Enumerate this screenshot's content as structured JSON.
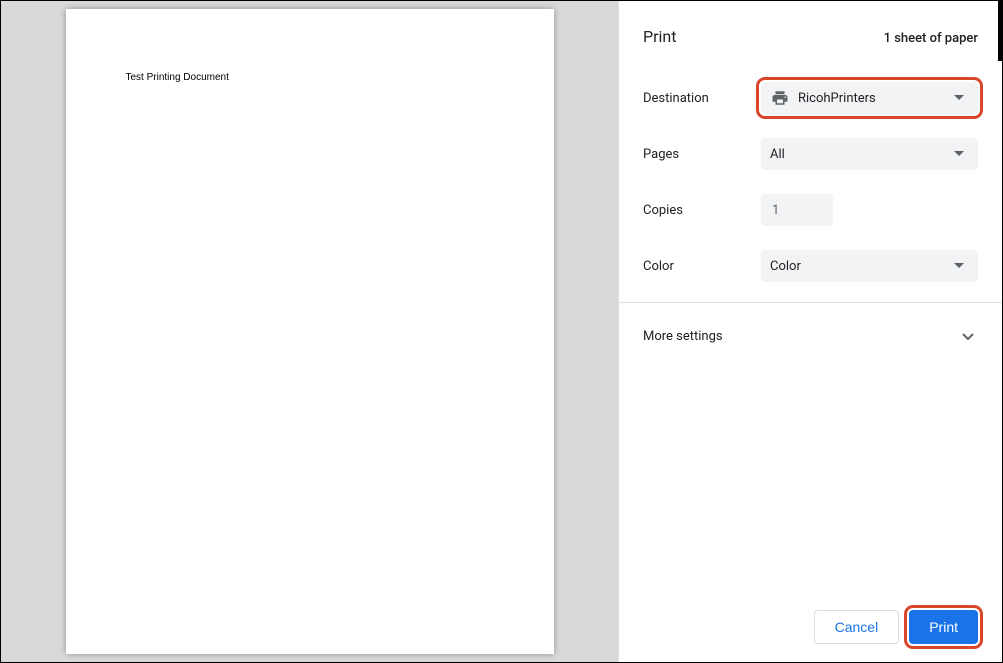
{
  "header": {
    "title": "Print",
    "sheet_info": "1 sheet of paper"
  },
  "preview": {
    "document_text": "Test Printing Document"
  },
  "settings": {
    "destination": {
      "label": "Destination",
      "value": "RicohPrinters"
    },
    "pages": {
      "label": "Pages",
      "value": "All"
    },
    "copies": {
      "label": "Copies",
      "value": "1"
    },
    "color": {
      "label": "Color",
      "value": "Color"
    }
  },
  "more_settings": {
    "label": "More settings"
  },
  "footer": {
    "cancel": "Cancel",
    "print": "Print"
  }
}
